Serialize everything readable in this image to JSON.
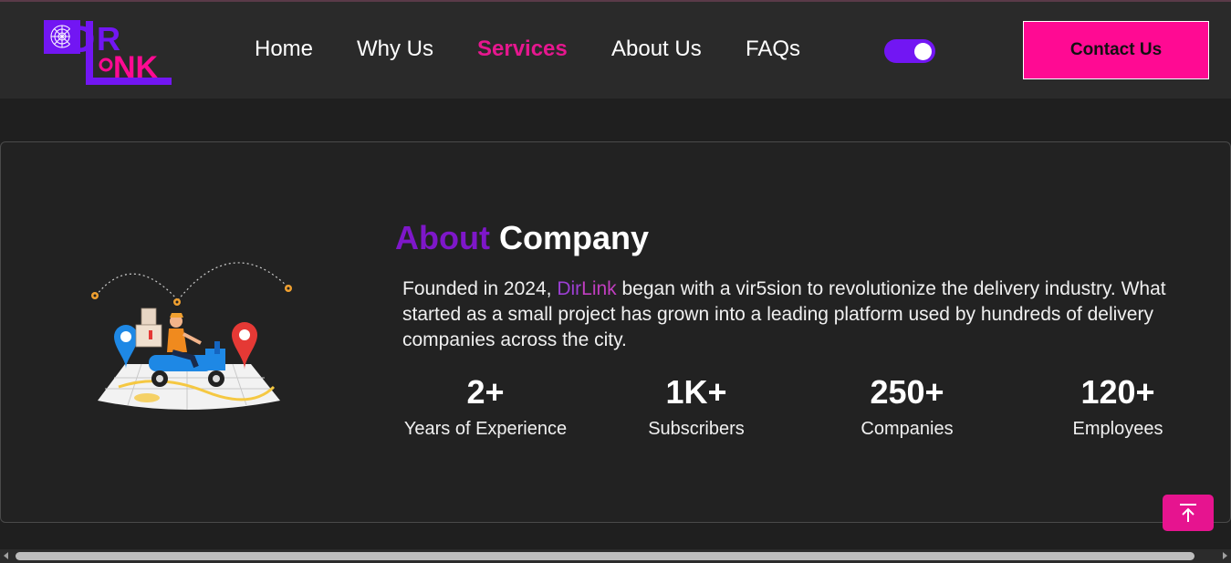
{
  "colors": {
    "brand_purple": "#7216f3",
    "brand_pink": "#ff0a93",
    "active_link": "#e6178f",
    "background": "#1f1f1f",
    "header_background": "#2a2a2a"
  },
  "header": {
    "logo_text": "DirLink",
    "nav": [
      {
        "label": "Home",
        "active": false
      },
      {
        "label": "Why Us",
        "active": false
      },
      {
        "label": "Services",
        "active": true
      },
      {
        "label": "About Us",
        "active": false
      },
      {
        "label": "FAQs",
        "active": false
      }
    ],
    "theme_toggle": {
      "icon": "toggle-switch",
      "state": "on"
    },
    "contact_label": "Contact Us"
  },
  "about": {
    "title_accent": "About",
    "title_rest": "Company",
    "illustration_icon": "delivery-scooter-map-illustration",
    "text_before": "Founded in 2024, ",
    "brand_dir": "Dir",
    "brand_link": "Link",
    "text_after": " began with a vir5sion to revolutionize the delivery industry. What started as a small project has grown into a leading platform used by hundreds of delivery companies across the city.",
    "stats": [
      {
        "value": "2+",
        "label": "Years of Experience"
      },
      {
        "value": "1K+",
        "label": "Subscribers"
      },
      {
        "value": "250+",
        "label": "Companies"
      },
      {
        "value": "120+",
        "label": "Employees"
      }
    ]
  },
  "scroll_top": {
    "icon": "arrow-up-to-line-icon"
  }
}
